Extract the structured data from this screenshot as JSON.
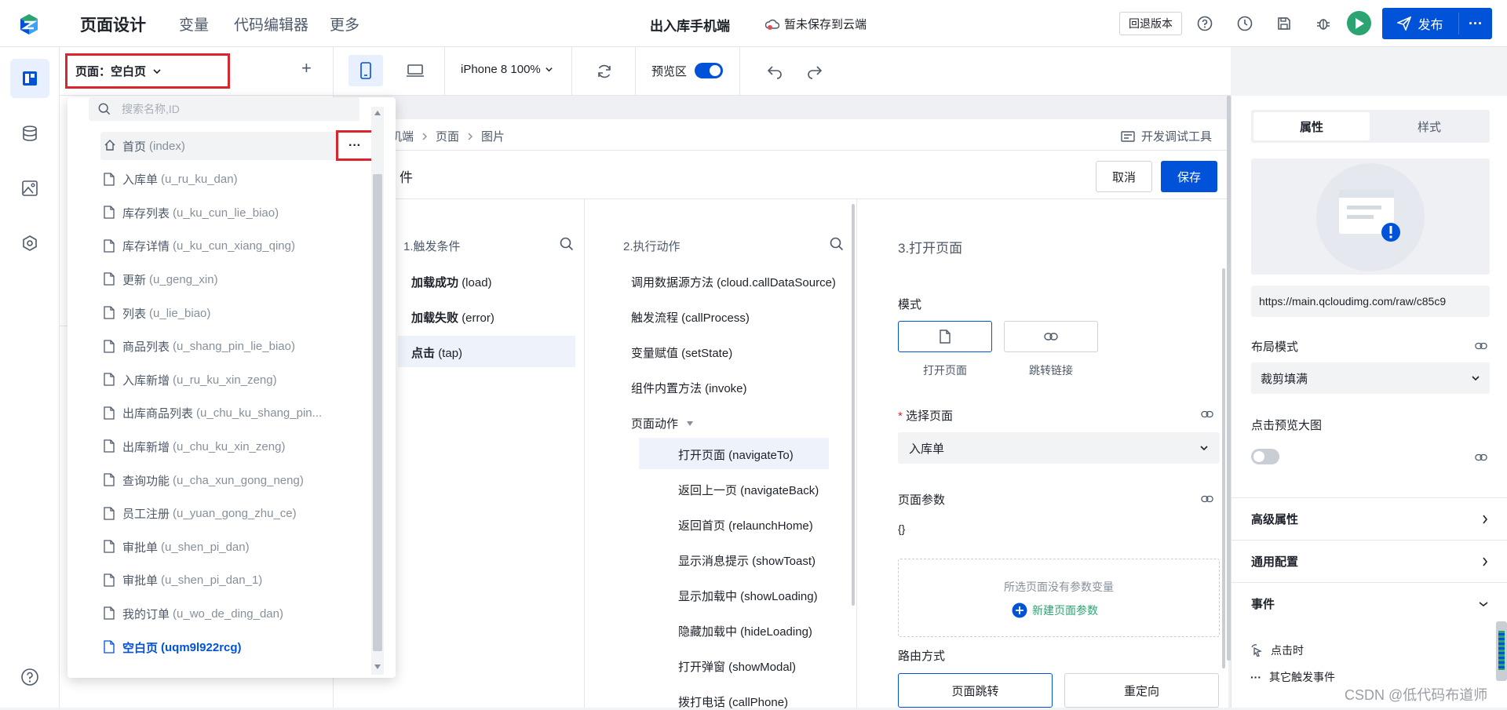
{
  "topbar": {
    "title": "页面设计",
    "nav": [
      "变量",
      "代码编辑器",
      "更多"
    ],
    "app_name": "出入库手机端",
    "save_status": "暂未保存到云端",
    "revert_label": "回退版本",
    "publish_label": "发布",
    "more_label": "···"
  },
  "page_selector": {
    "label": "页面：空白页",
    "add": "+"
  },
  "toolbar": {
    "device": "iPhone 8 100%",
    "preview_label": "预览区",
    "preview_on": true
  },
  "page_list": {
    "search_placeholder": "搜索名称,ID",
    "more_label": "···",
    "items": [
      {
        "name": "首页",
        "id": "(index)"
      },
      {
        "name": "入库单",
        "id": "(u_ru_ku_dan)"
      },
      {
        "name": "库存列表",
        "id": "(u_ku_cun_lie_biao)"
      },
      {
        "name": "库存详情",
        "id": "(u_ku_cun_xiang_qing)"
      },
      {
        "name": "更新",
        "id": "(u_geng_xin)"
      },
      {
        "name": "列表",
        "id": "(u_lie_biao)"
      },
      {
        "name": "商品列表",
        "id": "(u_shang_pin_lie_biao)"
      },
      {
        "name": "入库新增",
        "id": "(u_ru_ku_xin_zeng)"
      },
      {
        "name": "出库商品列表",
        "id": "(u_chu_ku_shang_pin..."
      },
      {
        "name": "出库新增",
        "id": "(u_chu_ku_xin_zeng)"
      },
      {
        "name": "查询功能",
        "id": "(u_cha_xun_gong_neng)"
      },
      {
        "name": "员工注册",
        "id": "(u_yuan_gong_zhu_ce)"
      },
      {
        "name": "审批单",
        "id": "(u_shen_pi_dan)"
      },
      {
        "name": "审批单",
        "id": "(u_shen_pi_dan_1)"
      },
      {
        "name": "我的订单",
        "id": "(u_wo_de_ding_dan)"
      },
      {
        "name": "空白页",
        "id": "(uqm9l922rcg)"
      }
    ]
  },
  "breadcrumb": [
    "机端",
    "页面",
    "图片"
  ],
  "dev_tools_label": "开发调试工具",
  "dialog": {
    "title_fragment": "件",
    "cancel": "取消",
    "save": "保存",
    "triggers_title": "1.触发条件",
    "triggers": [
      {
        "bold": "加载成功",
        "code": "(load)"
      },
      {
        "bold": "加载失败",
        "code": "(error)"
      },
      {
        "bold": "点击",
        "code": "(tap)"
      }
    ],
    "actions_title": "2.执行动作",
    "actions": [
      "调用数据源方法 (cloud.callDataSource)",
      "触发流程 (callProcess)",
      "变量赋值 (setState)",
      "组件内置方法 (invoke)",
      "页面动作"
    ],
    "page_actions": [
      "打开页面 (navigateTo)",
      "返回上一页 (navigateBack)",
      "返回首页 (relaunchHome)",
      "显示消息提示 (showToast)",
      "显示加载中 (showLoading)",
      "隐藏加载中 (hideLoading)",
      "打开弹窗 (showModal)",
      "拨打电话 (callPhone)"
    ],
    "config_title": "3.打开页面",
    "mode_label": "模式",
    "mode_options": [
      "打开页面",
      "跳转链接"
    ],
    "select_page_label": "选择页面",
    "select_page_value": "入库单",
    "params_label": "页面参数",
    "params_value": "{}",
    "params_empty": "所选页面没有参数变量",
    "params_new": "新建页面参数",
    "route_label": "路由方式",
    "route_options": [
      "页面跳转",
      "重定向"
    ]
  },
  "right_panel": {
    "tabs": [
      "属性",
      "样式"
    ],
    "image_url": "https://main.qcloudimg.com/raw/c85c9",
    "layout_label": "布局模式",
    "layout_value": "裁剪填满",
    "preview_label": "点击预览大图",
    "preview_on": false,
    "sections": [
      "高级属性",
      "通用配置",
      "事件"
    ],
    "events": [
      "点击时",
      "其它触发事件"
    ]
  },
  "watermark": "CSDN @低代码布道师",
  "colors": {
    "accent": "#0052d9",
    "highlight": "#d9262c",
    "green": "#2ba471"
  }
}
